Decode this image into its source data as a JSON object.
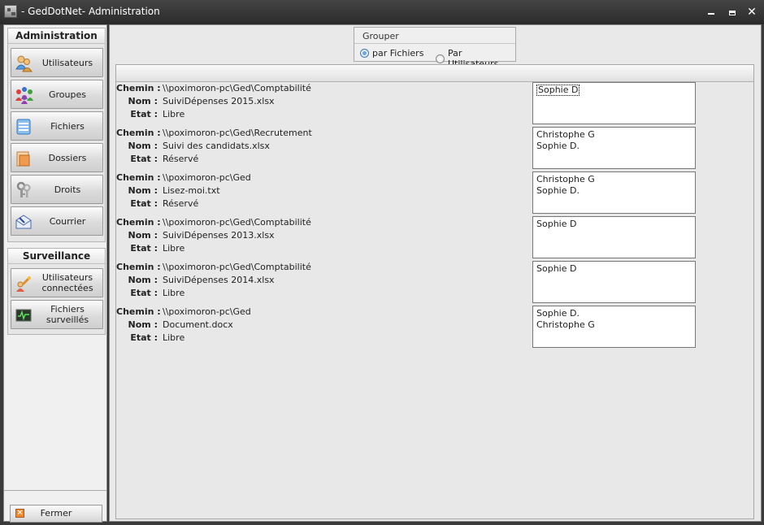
{
  "window": {
    "title": "- GedDotNet- Administration",
    "close_glyph": "✕"
  },
  "sidebar": {
    "administration_title": "Administration",
    "admin_items": [
      {
        "label": "Utilisateurs",
        "icon": "users-icon"
      },
      {
        "label": "Groupes",
        "icon": "groups-icon"
      },
      {
        "label": "Fichiers",
        "icon": "files-icon"
      },
      {
        "label": "Dossiers",
        "icon": "folder-icon"
      },
      {
        "label": "Droits",
        "icon": "keys-icon"
      },
      {
        "label": "Courrier",
        "icon": "mail-icon"
      }
    ],
    "surveillance_title": "Surveillance",
    "surveillance_items": [
      {
        "label": "Utilisateurs connectées",
        "icon": "connected-users-icon"
      },
      {
        "label": "Fichiers surveillés",
        "icon": "monitor-icon"
      }
    ],
    "close_label": "Fermer"
  },
  "grouper": {
    "title": "Grouper",
    "options": [
      {
        "label": "par Fichiers",
        "checked": true
      },
      {
        "label": "Par Utilisateurs",
        "checked": false
      }
    ]
  },
  "field_labels": {
    "chemin": "Chemin :",
    "nom": "Nom :",
    "etat": "Etat :"
  },
  "entries": [
    {
      "chemin": "\\\\poximoron-pc\\Ged\\Comptabilité",
      "nom": "SuiviDépenses 2015.xlsx",
      "etat": "Libre",
      "users": [
        "Sophie D"
      ]
    },
    {
      "chemin": "\\\\poximoron-pc\\Ged\\Recrutement",
      "nom": "Suivi des candidats.xlsx",
      "etat": "Réservé",
      "users": [
        "Christophe G",
        "Sophie D."
      ]
    },
    {
      "chemin": "\\\\poximoron-pc\\Ged",
      "nom": "Lisez-moi.txt",
      "etat": "Réservé",
      "users": [
        "Christophe G",
        "Sophie D."
      ]
    },
    {
      "chemin": "\\\\poximoron-pc\\Ged\\Comptabilité",
      "nom": "SuiviDépenses 2013.xlsx",
      "etat": "Libre",
      "users": [
        "Sophie D"
      ]
    },
    {
      "chemin": "\\\\poximoron-pc\\Ged\\Comptabilité",
      "nom": "SuiviDépenses 2014.xlsx",
      "etat": "Libre",
      "users": [
        "Sophie D"
      ]
    },
    {
      "chemin": "\\\\poximoron-pc\\Ged",
      "nom": "Document.docx",
      "etat": "Libre",
      "users": [
        "Sophie D.",
        "Christophe G"
      ]
    }
  ]
}
